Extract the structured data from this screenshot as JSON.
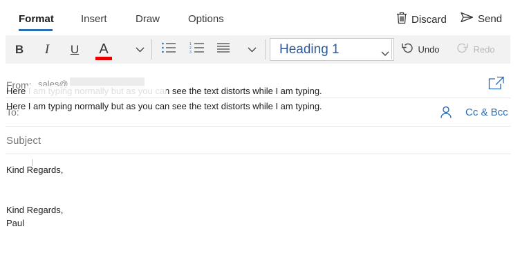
{
  "tabs": [
    {
      "label": "Format",
      "active": true
    },
    {
      "label": "Insert",
      "active": false
    },
    {
      "label": "Draw",
      "active": false
    },
    {
      "label": "Options",
      "active": false
    }
  ],
  "actions": {
    "discard_label": "Discard",
    "discard_icon": "trash-icon",
    "send_label": "Send",
    "send_icon": "send-icon"
  },
  "toolbar": {
    "bold": "B",
    "italic": "I",
    "underline": "U",
    "font_color_letter": "A",
    "font_color": "#e60000",
    "style_value": "Heading 1",
    "undo_label": "Undo",
    "redo_label": "Redo"
  },
  "header": {
    "from_label": "From:",
    "from_value": "sales@",
    "to_label": "To:",
    "subject_placeholder": "Subject",
    "cc_bcc_label": "Cc & Bcc"
  },
  "overlay": {
    "line1": "Here I am typing normally but as you can see the text distorts while I am typing.",
    "line2": "Here I am typing normally but as you can see the text distorts while I am typing."
  },
  "body": {
    "lines": [
      "Kind Regards,",
      "",
      "",
      "Kind Regards,",
      "Paul"
    ]
  },
  "colors": {
    "accent": "#2a6db5",
    "toolbar_bg": "#f2f2f2"
  }
}
